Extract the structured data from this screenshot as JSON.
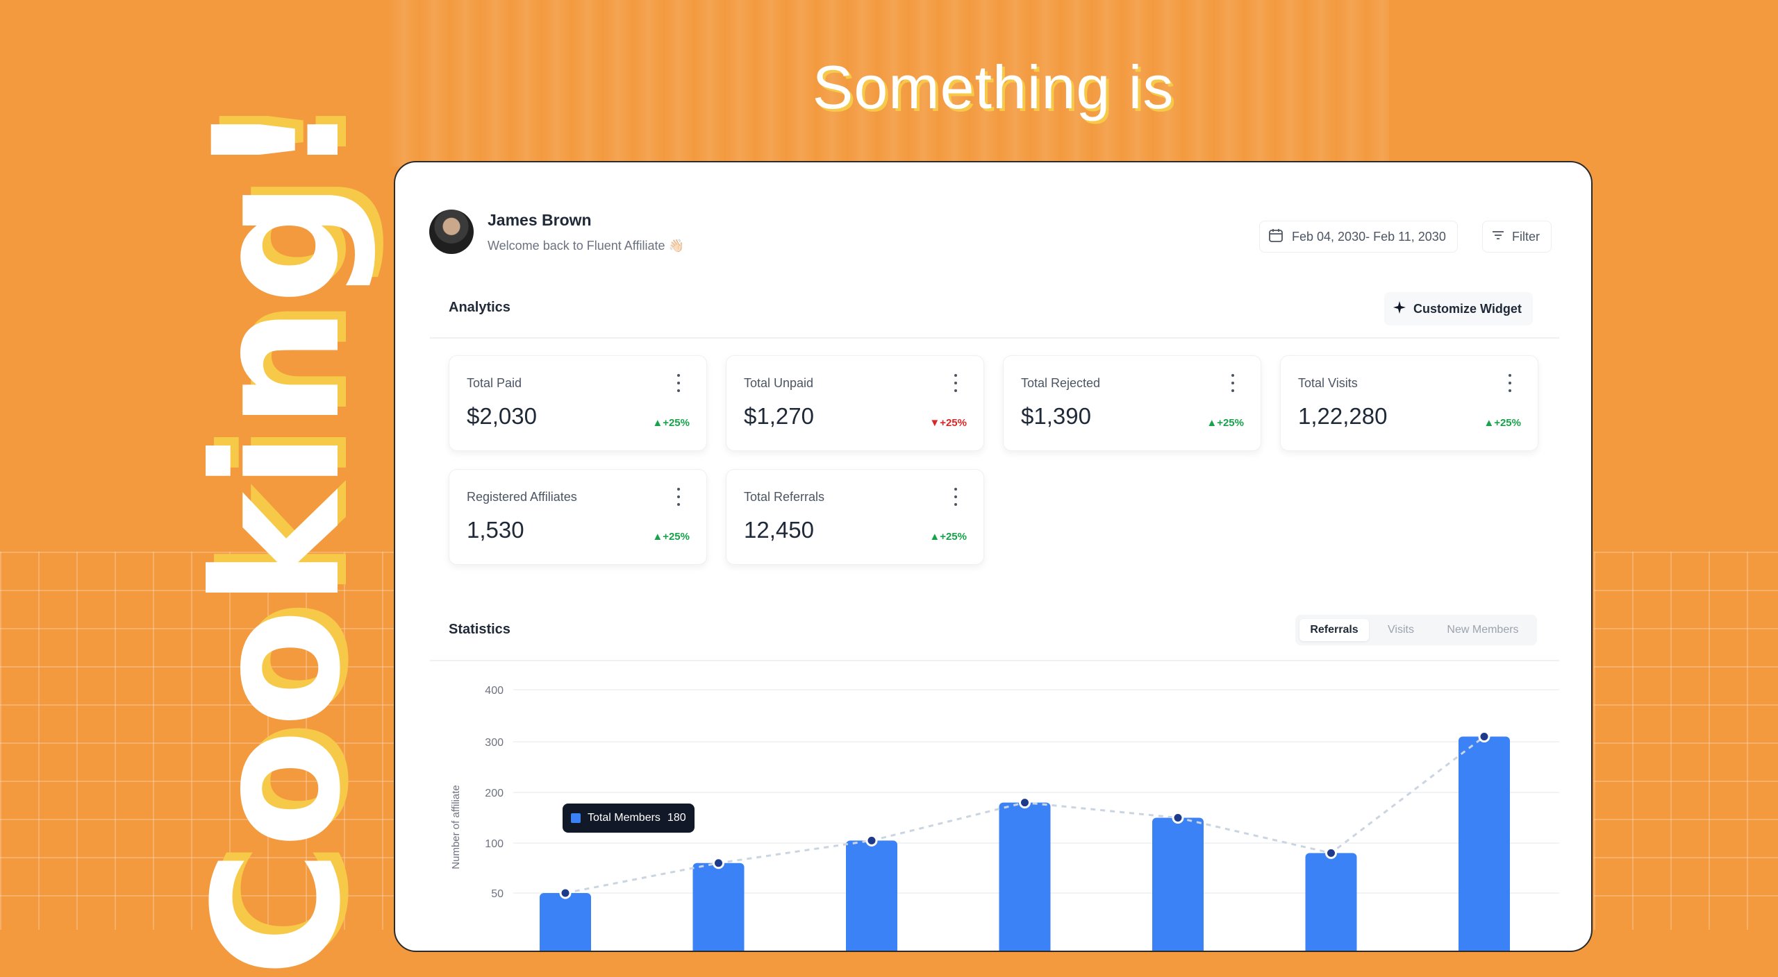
{
  "headline": "Something is",
  "vertical_word": "Cooking!",
  "header": {
    "user_name": "James Brown",
    "welcome": "Welcome back to Fluent Affiliate 👋🏻",
    "date_range": "Feb 04, 2030- Feb 11, 2030",
    "filter_label": "Filter"
  },
  "analytics": {
    "title": "Analytics",
    "customize_label": "Customize Widget",
    "cards": [
      {
        "label": "Total Paid",
        "value": "$2,030",
        "change": "+25%",
        "trend": "up"
      },
      {
        "label": "Total Unpaid",
        "value": "$1,270",
        "change": "+25%",
        "trend": "down"
      },
      {
        "label": "Total Rejected",
        "value": "$1,390",
        "change": "+25%",
        "trend": "up"
      },
      {
        "label": "Total Visits",
        "value": "1,22,280",
        "change": "+25%",
        "trend": "up"
      },
      {
        "label": "Registered Affiliates",
        "value": "1,530",
        "change": "+25%",
        "trend": "up"
      },
      {
        "label": "Total Referrals",
        "value": "12,450",
        "change": "+25%",
        "trend": "up"
      }
    ]
  },
  "statistics": {
    "title": "Statistics",
    "tabs": [
      "Referrals",
      "Visits",
      "New Members"
    ],
    "active_tab": "Referrals",
    "tooltip": {
      "label": "Total Members",
      "value": "180"
    }
  },
  "colors": {
    "background": "#f39a3f",
    "accent": "#f7c948",
    "bar": "#3b82f6",
    "up": "#16a34a",
    "down": "#dc2626"
  },
  "chart_data": {
    "type": "bar",
    "ylabel": "Number of affiliate",
    "y_ticks": [
      50,
      100,
      200,
      300,
      400
    ],
    "values": [
      50,
      80,
      105,
      180,
      150,
      90,
      310
    ],
    "line_overlay": true,
    "grid": true
  }
}
